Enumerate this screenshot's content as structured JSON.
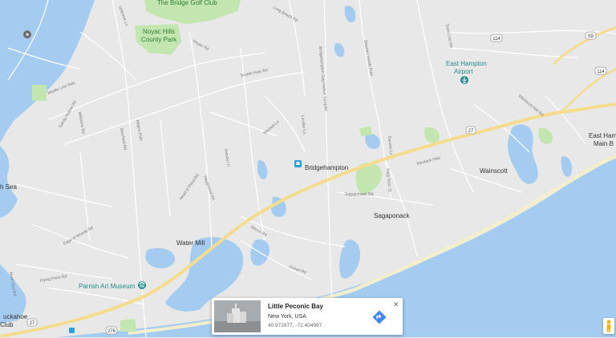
{
  "map": {
    "places": {
      "bridge_golf_club": "The Bridge Golf Club",
      "noyac_hills_line1": "Noyac Hills",
      "noyac_hills_line2": "County Park",
      "east_hampton_airport_line1": "East Hampton",
      "east_hampton_airport_line2": "Airport",
      "east_hampton_main_line1": "East Ham",
      "east_hampton_main_line2": "Main B",
      "bridgehampton": "Bridgehampton",
      "wainscott": "Wainscott",
      "sagaponack": "Sagaponack",
      "water_mill": "Water Mill",
      "parrish_art_museum": "Parrish Art Museum",
      "sea_fragment": "h Sea",
      "tuckahoe_fragment": "uckahoe",
      "club_fragment": "Club"
    },
    "shields": {
      "r114_top": "114",
      "r59": "59",
      "r114_right": "114",
      "r27": "27",
      "r27_left": "27",
      "r276": "276"
    },
    "roads": {
      "middle_line_hwy": "Middle Line Hwy",
      "scuttle_hole_rd": "Scuttle Hole Rd",
      "bridgehampton_sag_harbor_tpke": "Bridgehampton Sag Harbor Turnpike",
      "stephen_hands_path": "Stephen Hands Path",
      "lumber_ln": "Lumber Ln",
      "mitchell_ln": "Mitchell Ln",
      "sagaponack_rd": "Sagaponack Rd",
      "montauk_hwy": "Montauk Hwy",
      "deerfield_rd": "Deerfield Rd",
      "head_of_pond_rd": "Head of Pond Rd",
      "mecox_rd": "Mecox Rd",
      "ocean_rd": "Ocean Rd",
      "sagg_main_st": "Sagg Main St",
      "daniels_ln": "Daniels Ln",
      "edge_of_woods_rd": "Edge of Woods Rd",
      "flying_point_rd": "Flying Point Rd",
      "halsey_ln": "Halsey Ln",
      "noyac_rd": "Noyac Rd",
      "long_beach_rd": "Long Beach Rd",
      "sandy_hollow_rd": "Sandy Hollow Rd",
      "north_sea_rd": "North Sea Rd",
      "majors_path": "Majors Path",
      "hayground_rd": "Hayground Rd",
      "millstone_rd": "Millstone Rd",
      "town_line_rd": "Town Line Rd",
      "wainscott_nw_rd": "Wainscott NW Rd",
      "osborne_ln": "Osborne Ln"
    }
  },
  "info_card": {
    "title": "Little Peconic Bay",
    "subtitle": "New York, USA",
    "coordinates": "40.972877, -72.404987",
    "close_glyph": "✕"
  },
  "colors": {
    "land": "#e8e8e8",
    "water": "#a3ccf0",
    "park": "#c3e6b0",
    "highway": "#f5dc8c",
    "road": "#ffffff",
    "beach": "#f3efcc",
    "accent_blue": "#4285f4",
    "teal_poi": "#1f8a8a"
  },
  "icons": {
    "airport": "airport-icon",
    "museum": "museum-icon",
    "transit": "train-station-icon",
    "directions": "directions-icon",
    "close": "close-icon",
    "pegman": "pegman-icon",
    "marker": "place-marker-icon"
  }
}
